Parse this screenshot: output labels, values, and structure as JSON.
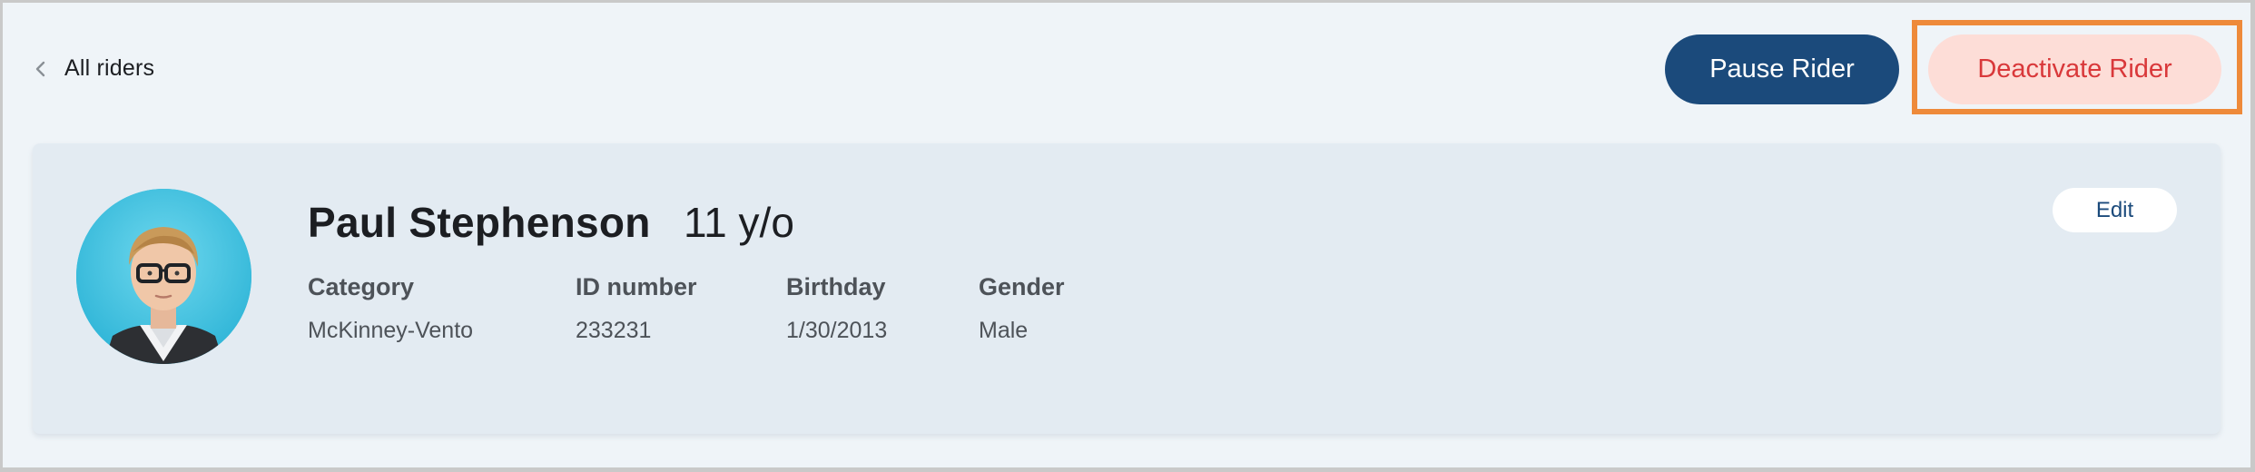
{
  "nav": {
    "back_label": "All riders",
    "back_icon": "chevron-left-icon"
  },
  "actions": {
    "pause_label": "Pause Rider",
    "deactivate_label": "Deactivate Rider"
  },
  "rider": {
    "name": "Paul Stephenson",
    "age": "11 y/o",
    "edit_label": "Edit",
    "fields": [
      {
        "label": "Category",
        "value": "McKinney-Vento"
      },
      {
        "label": "ID number",
        "value": "233231"
      },
      {
        "label": "Birthday",
        "value": "1/30/2013"
      },
      {
        "label": "Gender",
        "value": "Male"
      }
    ]
  },
  "colors": {
    "page_bg": "#eff4f8",
    "card_bg": "#e3ebf2",
    "primary": "#1b4a7b",
    "danger_text": "#d9383a",
    "danger_bg": "#fdddd7",
    "highlight": "#ee8a3a",
    "avatar_bg": "#38bfe0"
  }
}
